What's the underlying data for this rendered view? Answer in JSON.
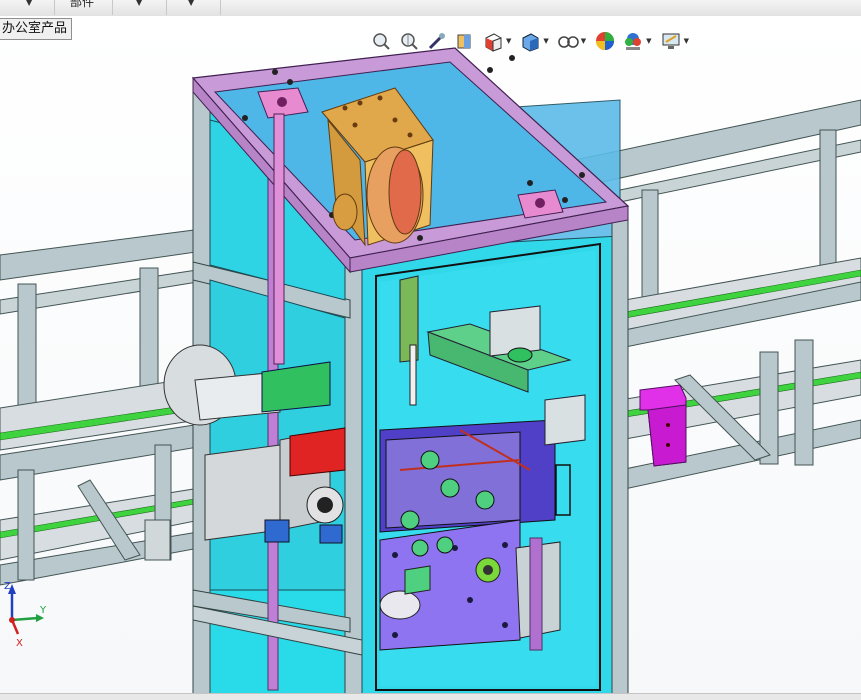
{
  "top_menu": {
    "items": [
      {
        "label": "",
        "has_dropdown": true
      },
      {
        "label": "部件",
        "has_dropdown": false
      },
      {
        "label": "",
        "has_dropdown": true
      },
      {
        "label": "",
        "has_dropdown": true
      }
    ]
  },
  "tab": {
    "label": "办公室产品"
  },
  "view_toolbar": {
    "tools": [
      {
        "icon": "zoom-to-fit-icon",
        "has_dropdown": false
      },
      {
        "icon": "zoom-to-area-icon",
        "has_dropdown": false
      },
      {
        "icon": "previous-view-icon",
        "has_dropdown": false
      },
      {
        "icon": "section-view-icon",
        "has_dropdown": false
      },
      {
        "icon": "view-orientation-icon",
        "has_dropdown": true
      },
      {
        "icon": "display-style-icon",
        "has_dropdown": true
      },
      {
        "icon": "hide-show-items-icon",
        "has_dropdown": true
      },
      {
        "icon": "edit-appearance-icon",
        "has_dropdown": false
      },
      {
        "icon": "apply-scene-icon",
        "has_dropdown": true
      },
      {
        "icon": "view-settings-icon",
        "has_dropdown": true
      }
    ]
  },
  "triad": {
    "x_label": "X",
    "y_label": "Y",
    "z_label": "Z"
  },
  "colors": {
    "frame": "#b9c8cc",
    "glass": "#25e0f0",
    "top_plate": "#c89ad8",
    "pulley_bracket": "#e0a84a",
    "carriage": "#8f74f2",
    "rod": "#c07fd6",
    "rail_stripe": "#3fd43f",
    "magenta_part": "#e030e8",
    "red_part": "#e02424"
  }
}
